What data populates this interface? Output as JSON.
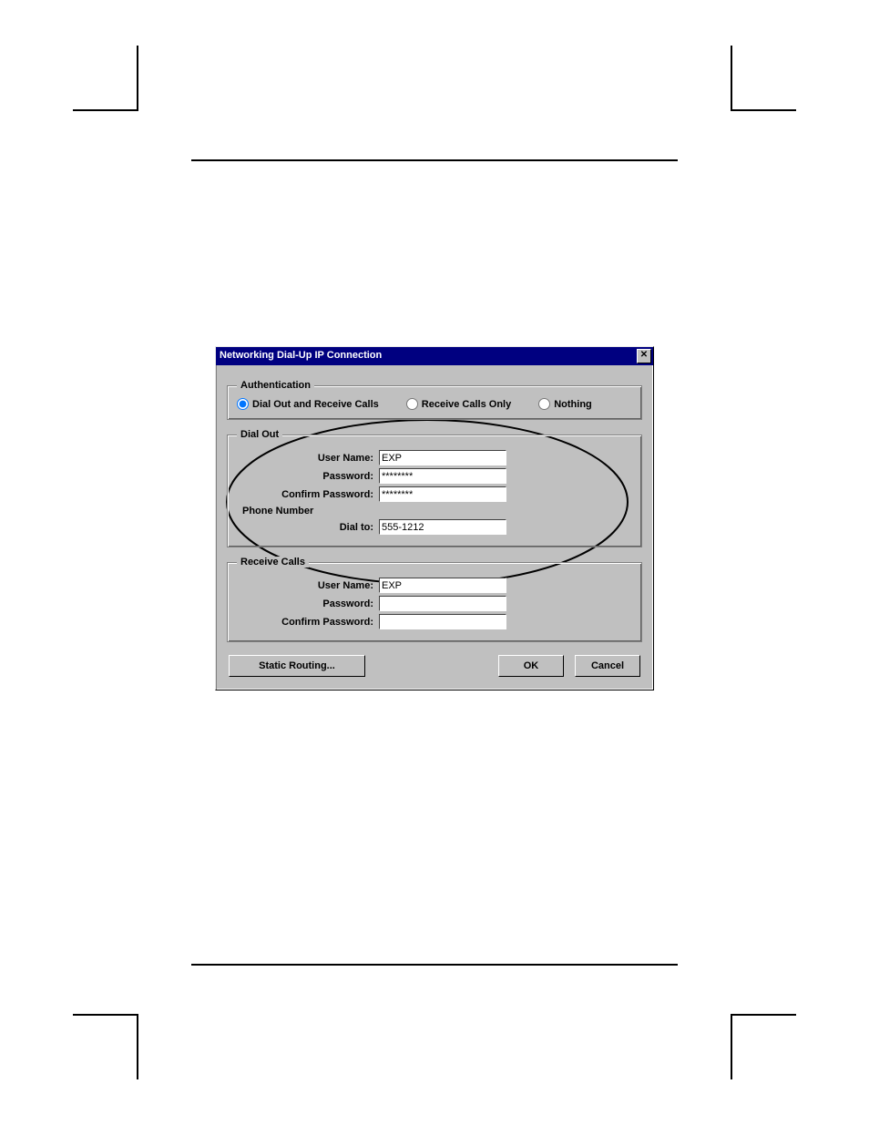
{
  "dialog": {
    "title": "Networking Dial-Up IP Connection",
    "close_glyph": "✕"
  },
  "auth": {
    "legend": "Authentication",
    "opt_dial_receive": "Dial Out and Receive Calls",
    "opt_receive_only": "Receive Calls Only",
    "opt_nothing": "Nothing"
  },
  "dialout": {
    "legend": "Dial Out",
    "user_label": "User Name:",
    "user_value": "EXP",
    "pass_label": "Password:",
    "pass_value": "********",
    "confirm_label": "Confirm Password:",
    "confirm_value": "********",
    "phone_section": "Phone Number",
    "dialto_label": "Dial to:",
    "dialto_value": "555-1212"
  },
  "receive": {
    "legend": "Receive Calls",
    "user_label": "User Name:",
    "user_value": "EXP",
    "pass_label": "Password:",
    "pass_value": "",
    "confirm_label": "Confirm Password:",
    "confirm_value": ""
  },
  "buttons": {
    "static_routing": "Static Routing...",
    "ok": "OK",
    "cancel": "Cancel"
  }
}
